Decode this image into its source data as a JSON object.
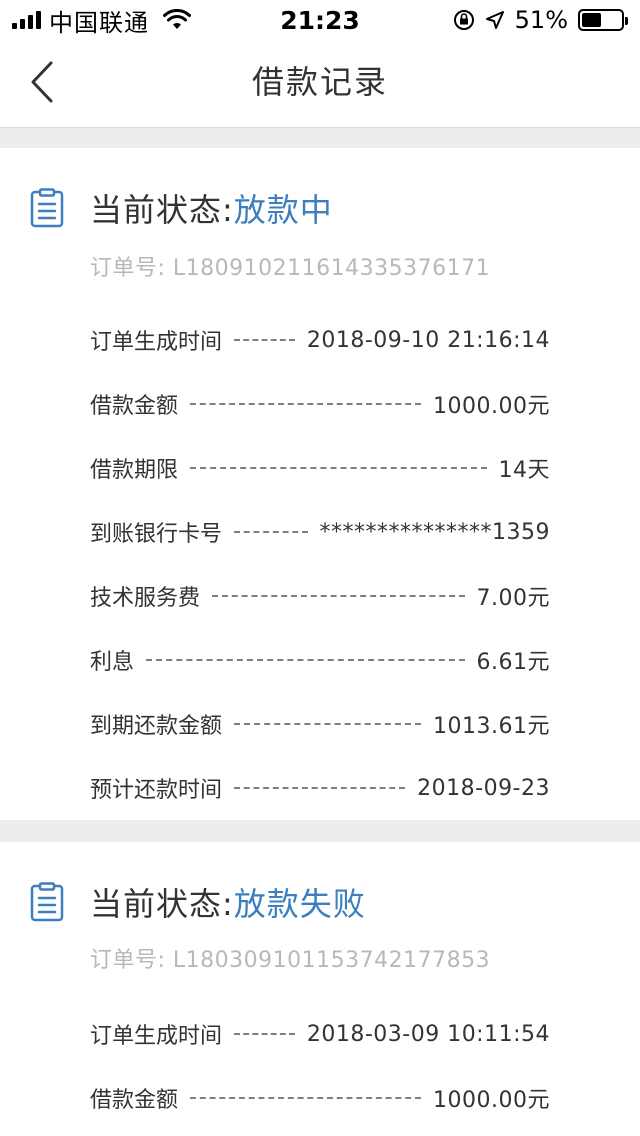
{
  "status_bar": {
    "carrier": "中国联通",
    "time": "21:23",
    "battery": "51%",
    "battery_level": 0.51
  },
  "nav": {
    "title": "借款记录",
    "back_icon": "chevron-left-icon"
  },
  "colors": {
    "accent": "#3c7fc0",
    "background": "#ededed"
  },
  "records": [
    {
      "status_label": "当前状态: ",
      "status_value": "放款中",
      "order_no": "订单号: L180910211614335376171",
      "rows": [
        {
          "label": "订单生成时间",
          "value": "2018-09-10 21:16:14"
        },
        {
          "label": "借款金额",
          "value": "1000.00元"
        },
        {
          "label": "借款期限",
          "value": "14天"
        },
        {
          "label": "到账银行卡号",
          "value": "***************1359"
        },
        {
          "label": "技术服务费",
          "value": "7.00元"
        },
        {
          "label": "利息",
          "value": "6.61元"
        },
        {
          "label": "到期还款金额",
          "value": "1013.61元"
        },
        {
          "label": "预计还款时间",
          "value": "2018-09-23"
        }
      ]
    },
    {
      "status_label": "当前状态: ",
      "status_value": "放款失败",
      "order_no": "订单号: L180309101153742177853",
      "rows": [
        {
          "label": "订单生成时间",
          "value": "2018-03-09 10:11:54"
        },
        {
          "label": "借款金额",
          "value": "1000.00元"
        }
      ]
    }
  ]
}
